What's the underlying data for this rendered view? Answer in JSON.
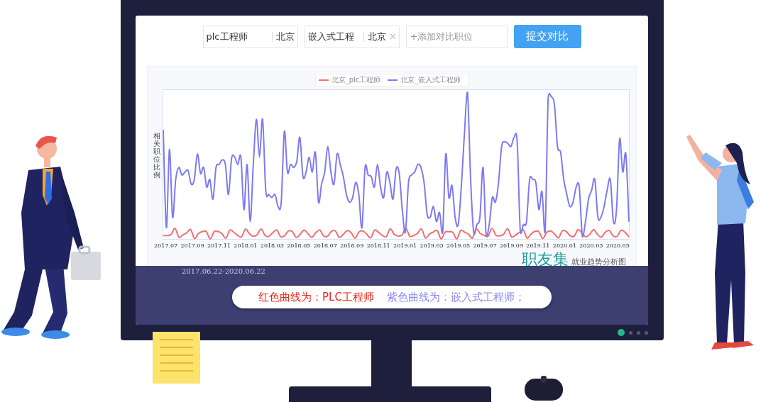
{
  "search_bar": {
    "fields": [
      {
        "kind": "tag",
        "job": "plc工程师",
        "city": "北京",
        "removable": false
      },
      {
        "kind": "tag",
        "job": "嵌入式工程",
        "city": "北京",
        "removable": true
      },
      {
        "kind": "input",
        "placeholder": "+添加对比职位"
      }
    ],
    "submit_button": "提交对比"
  },
  "chart": {
    "legend": [
      {
        "label": "北京_plc工程师",
        "color": "#f46e6e"
      },
      {
        "label": "北京_嵌入式工程师",
        "color": "#7d7af2"
      }
    ],
    "ylabel": "相关职位比例",
    "xlabels": [
      "2017.07",
      "2017.09",
      "2017.11",
      "2018.01",
      "2018.03",
      "2018.05",
      "2018.07",
      "2018.09",
      "2018.11",
      "2019.01",
      "2019.03",
      "2019.05",
      "2019.07",
      "2019.09",
      "2019.11",
      "2020.01",
      "2020.03",
      "2020.05"
    ],
    "date_range": "2017.06.22-2020.06.22",
    "brand": {
      "logo": "职友集",
      "tagline": "就业趋势分析图"
    }
  },
  "note": [
    {
      "text": "红色曲线为：PLC工程师",
      "color": "#e8231b"
    },
    {
      "text": "紫色曲线为：嵌入式工程师；",
      "color": "#8a87f2"
    }
  ],
  "pager": [
    {
      "selected": true
    },
    {
      "selected": false
    },
    {
      "selected": false
    },
    {
      "selected": false
    }
  ]
}
